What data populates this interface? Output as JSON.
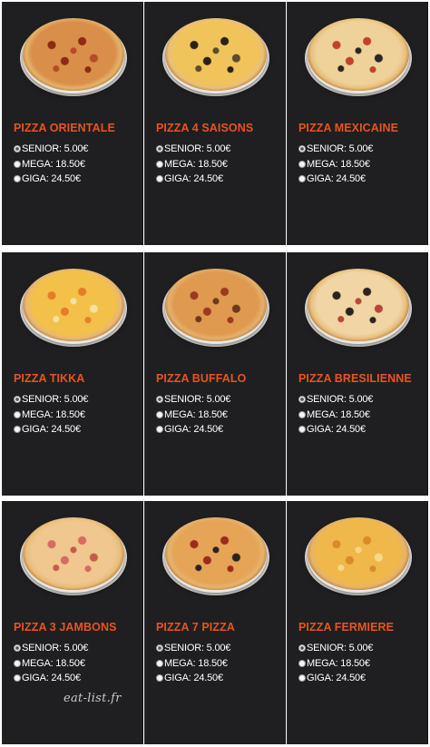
{
  "watermark": "eat-list.fr",
  "sections": [
    {
      "items": [
        {
          "name": "PIZZA ORIENTALE",
          "colors": {
            "top": "#d98f49",
            "crust": "#e3b36c",
            "dot1": "#8c2a16",
            "dot2": "#b84a2a"
          },
          "prices": [
            {
              "label": "SENIOR: 5.00€",
              "selected": true
            },
            {
              "label": "MEGA: 18.50€",
              "selected": false
            },
            {
              "label": "GIGA: 24.50€",
              "selected": false
            }
          ]
        },
        {
          "name": "PIZZA 4 SAISONS",
          "colors": {
            "top": "#f0c45a",
            "crust": "#e8c07a",
            "dot1": "#2b2018",
            "dot2": "#5c4a2c"
          },
          "prices": [
            {
              "label": "SENIOR: 5.00€",
              "selected": true
            },
            {
              "label": "MEGA: 18.50€",
              "selected": false
            },
            {
              "label": "GIGA: 24.50€",
              "selected": false
            }
          ]
        },
        {
          "name": "PIZZA MEXICAINE",
          "colors": {
            "top": "#efd29a",
            "crust": "#e7c07c",
            "dot1": "#c3412c",
            "dot2": "#2a2622"
          },
          "prices": [
            {
              "label": "SENIOR: 5.00€",
              "selected": true
            },
            {
              "label": "MEGA: 18.50€",
              "selected": false
            },
            {
              "label": "GIGA: 24.50€",
              "selected": false
            }
          ]
        }
      ]
    },
    {
      "items": [
        {
          "name": "PIZZA TIKKA",
          "colors": {
            "top": "#f3c04a",
            "crust": "#e5b877",
            "dot1": "#e47c2a",
            "dot2": "#f3e2a0"
          },
          "prices": [
            {
              "label": "SENIOR: 5.00€",
              "selected": true
            },
            {
              "label": "MEGA: 18.50€",
              "selected": false
            },
            {
              "label": "GIGA: 24.50€",
              "selected": false
            }
          ]
        },
        {
          "name": "PIZZA BUFFALO",
          "colors": {
            "top": "#e09a4f",
            "crust": "#e2b16f",
            "dot1": "#9a3a22",
            "dot2": "#6b3a1e"
          },
          "prices": [
            {
              "label": "SENIOR: 5.00€",
              "selected": true
            },
            {
              "label": "MEGA: 18.50€",
              "selected": false
            },
            {
              "label": "GIGA: 24.50€",
              "selected": false
            }
          ]
        },
        {
          "name": "PIZZA BRESILIENNE",
          "colors": {
            "top": "#f1d5a4",
            "crust": "#e7c07d",
            "dot1": "#2a2420",
            "dot2": "#b8463a"
          },
          "prices": [
            {
              "label": "SENIOR: 5.00€",
              "selected": true
            },
            {
              "label": "MEGA: 18.50€",
              "selected": false
            },
            {
              "label": "GIGA: 24.50€",
              "selected": false
            }
          ]
        }
      ]
    },
    {
      "items": [
        {
          "name": "PIZZA 3 JAMBONS",
          "colors": {
            "top": "#efc78f",
            "crust": "#e7bd79",
            "dot1": "#d66b61",
            "dot2": "#c85a4d"
          },
          "prices": [
            {
              "label": "SENIOR: 5.00€",
              "selected": true
            },
            {
              "label": "MEGA: 18.50€",
              "selected": false
            },
            {
              "label": "GIGA: 24.50€",
              "selected": false
            }
          ]
        },
        {
          "name": "PIZZA 7 PIZZA",
          "colors": {
            "top": "#e5a456",
            "crust": "#e3b571",
            "dot1": "#9c2a1e",
            "dot2": "#2a221e"
          },
          "prices": [
            {
              "label": "SENIOR: 5.00€",
              "selected": true
            },
            {
              "label": "MEGA: 18.50€",
              "selected": false
            },
            {
              "label": "GIGA: 24.50€",
              "selected": false
            }
          ]
        },
        {
          "name": "PIZZA FERMIERE",
          "colors": {
            "top": "#f0b84a",
            "crust": "#e4b36a",
            "dot1": "#d88a2c",
            "dot2": "#f6da8a"
          },
          "prices": [
            {
              "label": "SENIOR: 5.00€",
              "selected": true
            },
            {
              "label": "MEGA: 18.50€",
              "selected": false
            },
            {
              "label": "GIGA: 24.50€",
              "selected": false
            }
          ]
        }
      ]
    }
  ]
}
